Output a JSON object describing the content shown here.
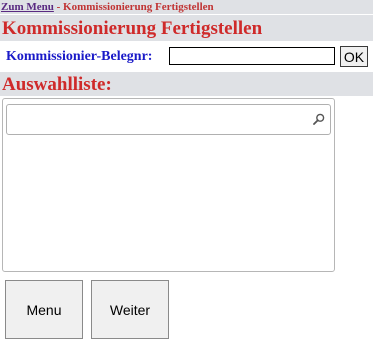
{
  "breadcrumb": {
    "link_label": "Zum Menu",
    "separator": " - ",
    "current": "Kommissionierung Fertigstellen"
  },
  "page": {
    "title": "Kommissionierung Fertigstellen"
  },
  "form": {
    "belegnr_label": "Kommissionier-Belegnr:",
    "belegnr_value": "",
    "ok_label": "OK"
  },
  "selection": {
    "heading": "Auswahlliste:",
    "search_value": "",
    "search_icon": "search-icon"
  },
  "actions": {
    "menu_label": "Menu",
    "weiter_label": "Weiter"
  },
  "colors": {
    "title_red": "#cf2a2a",
    "label_blue": "#1a1ac8",
    "link_purple": "#5a2a82",
    "bar_gray": "#dfe1e5"
  }
}
